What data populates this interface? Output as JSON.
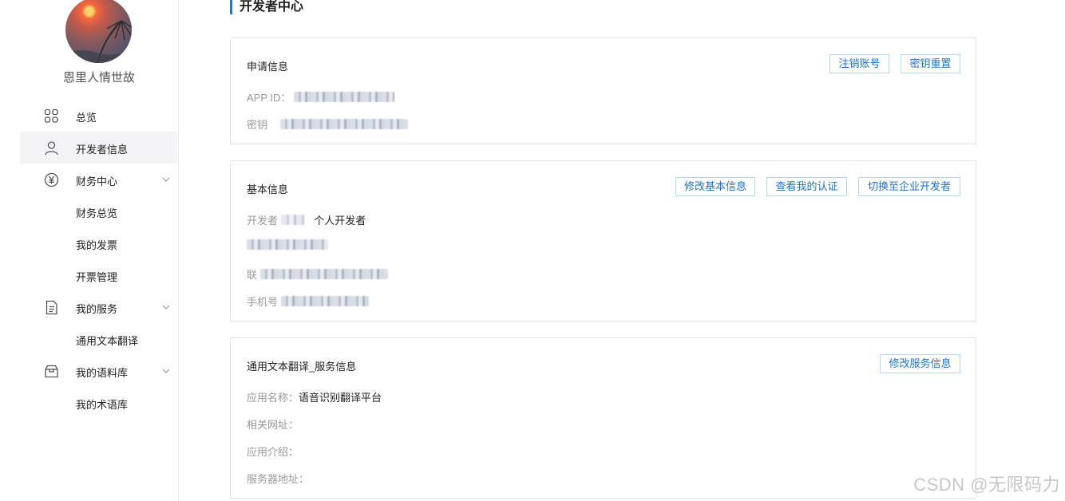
{
  "user": {
    "name": "恩里人情世故"
  },
  "sidebar": {
    "items": [
      {
        "label": "总览",
        "icon": "grid-icon",
        "type": "top"
      },
      {
        "label": "开发者信息",
        "icon": "user-icon",
        "type": "top",
        "active": true
      },
      {
        "label": "财务中心",
        "icon": "yen-icon",
        "type": "group",
        "expanded": true
      },
      {
        "label": "财务总览",
        "type": "sub"
      },
      {
        "label": "我的发票",
        "type": "sub"
      },
      {
        "label": "开票管理",
        "type": "sub"
      },
      {
        "label": "我的服务",
        "icon": "document-icon",
        "type": "group",
        "expanded": true
      },
      {
        "label": "通用文本翻译",
        "type": "sub"
      },
      {
        "label": "我的语料库",
        "icon": "box-icon",
        "type": "group",
        "expanded": true
      },
      {
        "label": "我的术语库",
        "type": "sub"
      }
    ]
  },
  "page": {
    "title": "开发者中心"
  },
  "application_card": {
    "title": "申请信息",
    "buttons": {
      "cancel_account": "注销账号",
      "reset_key": "密钥重置"
    },
    "app_id_label": "APP ID：",
    "key_label": "密钥"
  },
  "basic_card": {
    "title": "基本信息",
    "buttons": {
      "edit_basic": "修改基本信息",
      "view_auth": "查看我的认证",
      "switch_enterprise": "切换至企业开发者"
    },
    "developer_type_label": "开发者",
    "developer_type_value": "个人开发者",
    "contact_label": "联",
    "phone_label": "手机号"
  },
  "service_card": {
    "title": "通用文本翻译_服务信息",
    "buttons": {
      "edit_service": "修改服务信息"
    },
    "app_name_label": "应用名称：",
    "app_name_value": "语音识别翻译平台",
    "related_url_label": "相关网址：",
    "app_intro_label": "应用介绍：",
    "server_address_label": "服务器地址："
  },
  "watermark": "CSDN @无限码力",
  "colors": {
    "accent": "#1a73e8",
    "button_text": "#1d74d6",
    "button_border": "#b6d4f5",
    "active_bg": "#f4f4f6"
  }
}
